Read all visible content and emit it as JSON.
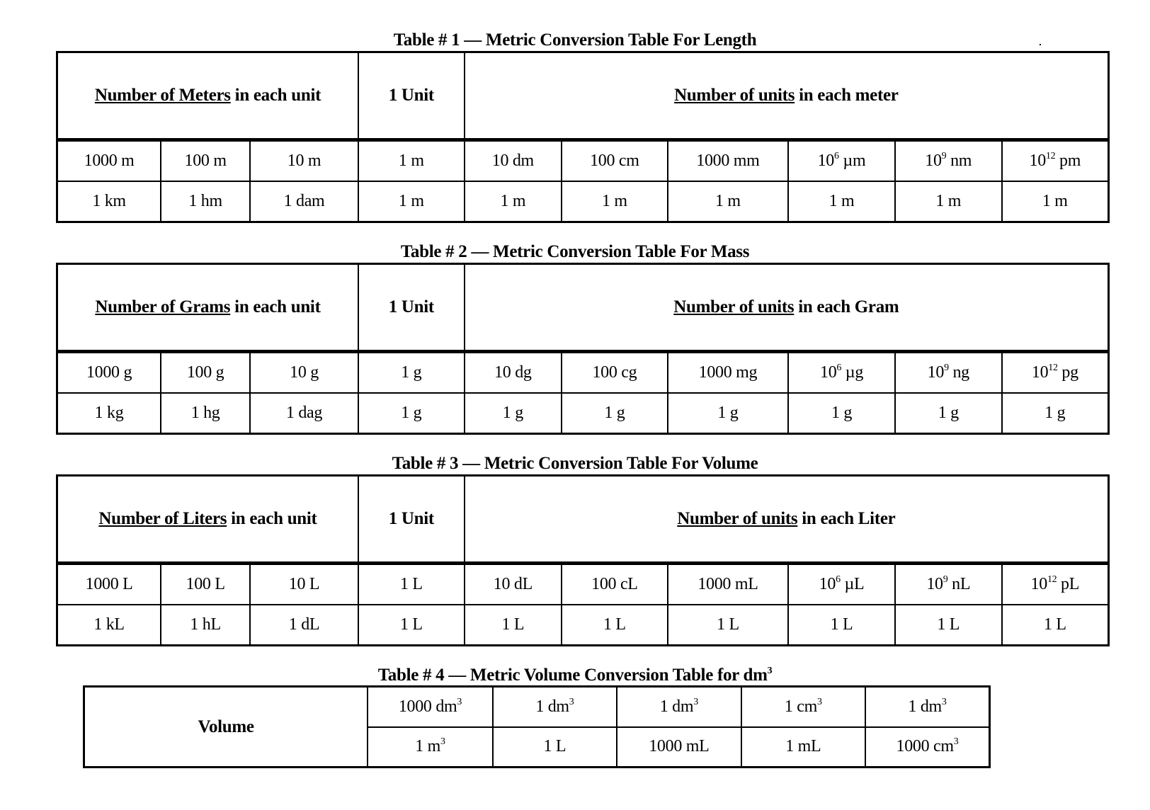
{
  "tables": [
    {
      "caption": "Table # 1 —  Metric Conversion Table For Length",
      "left_header_prefix": "Number of  Meters",
      "left_header_suffix": " in each unit",
      "unit_header": "1 Unit",
      "right_header_prefix": "Number of units",
      "right_header_suffix": " in each meter",
      "row1": [
        {
          "v": "1000 m"
        },
        {
          "v": "100 m"
        },
        {
          "v": "10 m"
        },
        {
          "v": "1 m"
        },
        {
          "v": "10 dm"
        },
        {
          "v": "100 cm"
        },
        {
          "v": "1000 mm"
        },
        {
          "b": "10",
          "e": "6",
          "u": " µm"
        },
        {
          "b": "10",
          "e": "9",
          "u": " nm"
        },
        {
          "b": "10",
          "e": "12",
          "u": " pm"
        }
      ],
      "row2": [
        "1 km",
        "1 hm",
        "1 dam",
        "1 m",
        "1 m",
        "1 m",
        "1 m",
        "1 m",
        "1 m",
        "1 m"
      ]
    },
    {
      "caption": "Table # 2 —  Metric Conversion Table For Mass",
      "left_header_prefix": "Number of Grams",
      "left_header_suffix": " in each unit",
      "unit_header": "1 Unit",
      "right_header_prefix": "Number of units",
      "right_header_suffix": " in each Gram",
      "row1": [
        {
          "v": "1000 g"
        },
        {
          "v": "100 g"
        },
        {
          "v": "10 g"
        },
        {
          "v": "1 g"
        },
        {
          "v": "10 dg"
        },
        {
          "v": "100 cg"
        },
        {
          "v": "1000 mg"
        },
        {
          "b": "10",
          "e": "6",
          "u": " µg"
        },
        {
          "b": "10",
          "e": "9",
          "u": " ng"
        },
        {
          "b": "10",
          "e": "12",
          "u": " pg"
        }
      ],
      "row2": [
        "1 kg",
        "1 hg",
        "1 dag",
        "1 g",
        "1 g",
        "1 g",
        "1 g",
        "1 g",
        "1 g",
        "1 g"
      ]
    },
    {
      "caption": "Table # 3 —  Metric Conversion Table For Volume",
      "left_header_prefix": "Number of Liters",
      "left_header_suffix": " in each unit",
      "unit_header": "1 Unit",
      "right_header_prefix": "Number of units",
      "right_header_suffix": " in each Liter",
      "row1": [
        {
          "v": "1000 L"
        },
        {
          "v": "100 L"
        },
        {
          "v": "10 L"
        },
        {
          "v": "1 L"
        },
        {
          "v": "10 dL"
        },
        {
          "v": "100 cL"
        },
        {
          "v": "1000 mL"
        },
        {
          "b": "10",
          "e": "6",
          "u": " µL"
        },
        {
          "b": "10",
          "e": "9",
          "u": " nL"
        },
        {
          "b": "10",
          "e": "12",
          "u": " pL"
        }
      ],
      "row2": [
        "1 kL",
        "1 hL",
        "1 dL",
        "1 L",
        "1 L",
        "1 L",
        "1 L",
        "1 L",
        "1 L",
        "1 L"
      ]
    }
  ],
  "table4": {
    "caption_prefix": "Table # 4 — Metric Volume Conversion Table for dm",
    "caption_exp": "3",
    "row_header": "Volume",
    "row1": [
      {
        "b": "1000 dm",
        "e": "3"
      },
      {
        "b": "1 dm",
        "e": "3"
      },
      {
        "b": "1 dm",
        "e": "3"
      },
      {
        "b": "1 cm",
        "e": "3"
      },
      {
        "b": "1 dm",
        "e": "3"
      }
    ],
    "row2": [
      {
        "b": "1 m",
        "e": "3"
      },
      {
        "b": "1 L"
      },
      {
        "b": "1000 mL"
      },
      {
        "b": "1 mL"
      },
      {
        "b": "1000 cm",
        "e": "3"
      }
    ]
  }
}
